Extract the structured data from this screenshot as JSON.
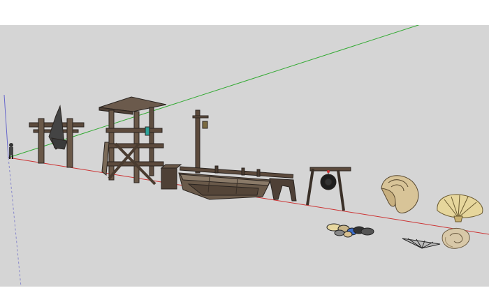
{
  "viewport": {
    "background_color": "#d5d5d5",
    "axis_colors": {
      "red": "#cc3333",
      "green": "#33aa33",
      "blue": "#6666cc"
    }
  },
  "objects": [
    "figure-icon",
    "torii-gate-icon",
    "watchtower-icon",
    "lamp-post-icon",
    "crate-icon",
    "rowboat-icon",
    "dock-rail-icon",
    "gong-icon",
    "conch-shell-icon",
    "scallop-shell-icon",
    "pebbles-icon",
    "fan-shell-icon",
    "snail-shell-icon"
  ]
}
